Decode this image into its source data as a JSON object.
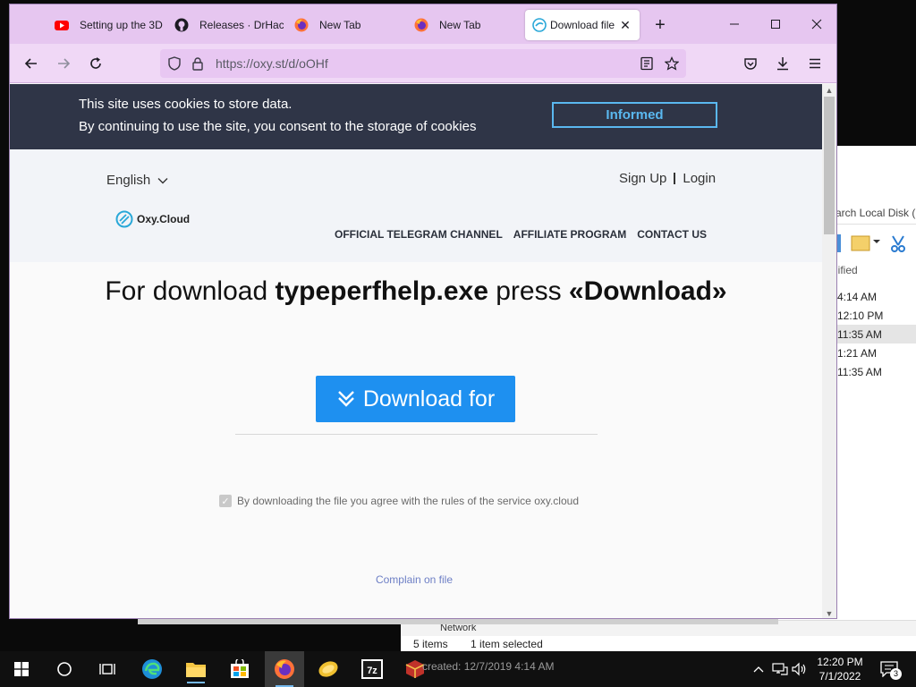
{
  "explorer": {
    "search_text": "arch Local Disk (C:)",
    "column_header": "lified",
    "times": [
      "4:14 AM",
      "12:10 PM",
      "11:35 AM",
      "1:21 AM",
      "11:35 AM"
    ],
    "network_label": "Network",
    "status_items": "5 items",
    "status_selected": "1 item selected"
  },
  "browser": {
    "tabs": [
      {
        "title": "Setting up the 3D"
      },
      {
        "title": "Releases · DrHack"
      },
      {
        "title": "New Tab"
      },
      {
        "title": "New Tab"
      },
      {
        "title": "Download file"
      }
    ],
    "url": "https://oxy.st/d/oOHf"
  },
  "cookie": {
    "line1": "This site uses cookies to store data.",
    "line2": "By continuing to use the site, you consent to the storage of cookies",
    "button": "Informed"
  },
  "page": {
    "language": "English",
    "sign_up": "Sign Up",
    "login": "Login",
    "logo_text": "Oxy.Cloud",
    "menu": [
      "OFFICIAL TELEGRAM CHANNEL",
      "AFFILIATE PROGRAM",
      "CONTACT US"
    ],
    "headline_pre": "For download ",
    "headline_file": "typeperfhelp.exe",
    "headline_mid": " press ",
    "headline_action": "«Download»",
    "download_button": "Download for",
    "agree_text": "By downloading the file you agree with the rules of the service oxy.cloud",
    "complain": "Complain on file"
  },
  "taskbar": {
    "created_text": "created: 12/7/2019 4:14 AM",
    "time": "12:20 PM",
    "date": "7/1/2022",
    "notifications": "3"
  },
  "colors": {
    "tabbar": "#e6c6f0",
    "navbar": "#f0d8f6",
    "cookie_bg": "#2f3547",
    "cookie_button": "#5ab8f0",
    "download_button": "#1e90f0",
    "complain_link": "#6d7fc5"
  },
  "icons": [
    "youtube-icon",
    "github-icon",
    "firefox-icon",
    "oxy-icon",
    "back-icon",
    "forward-icon",
    "reload-icon",
    "shield-icon",
    "lock-icon",
    "reader-icon",
    "star-icon",
    "pocket-icon",
    "download-icon",
    "menu-icon",
    "windows-start-icon",
    "search-icon",
    "task-view-icon",
    "edge-icon",
    "file-explorer-icon",
    "store-icon",
    "7zip-icon"
  ]
}
